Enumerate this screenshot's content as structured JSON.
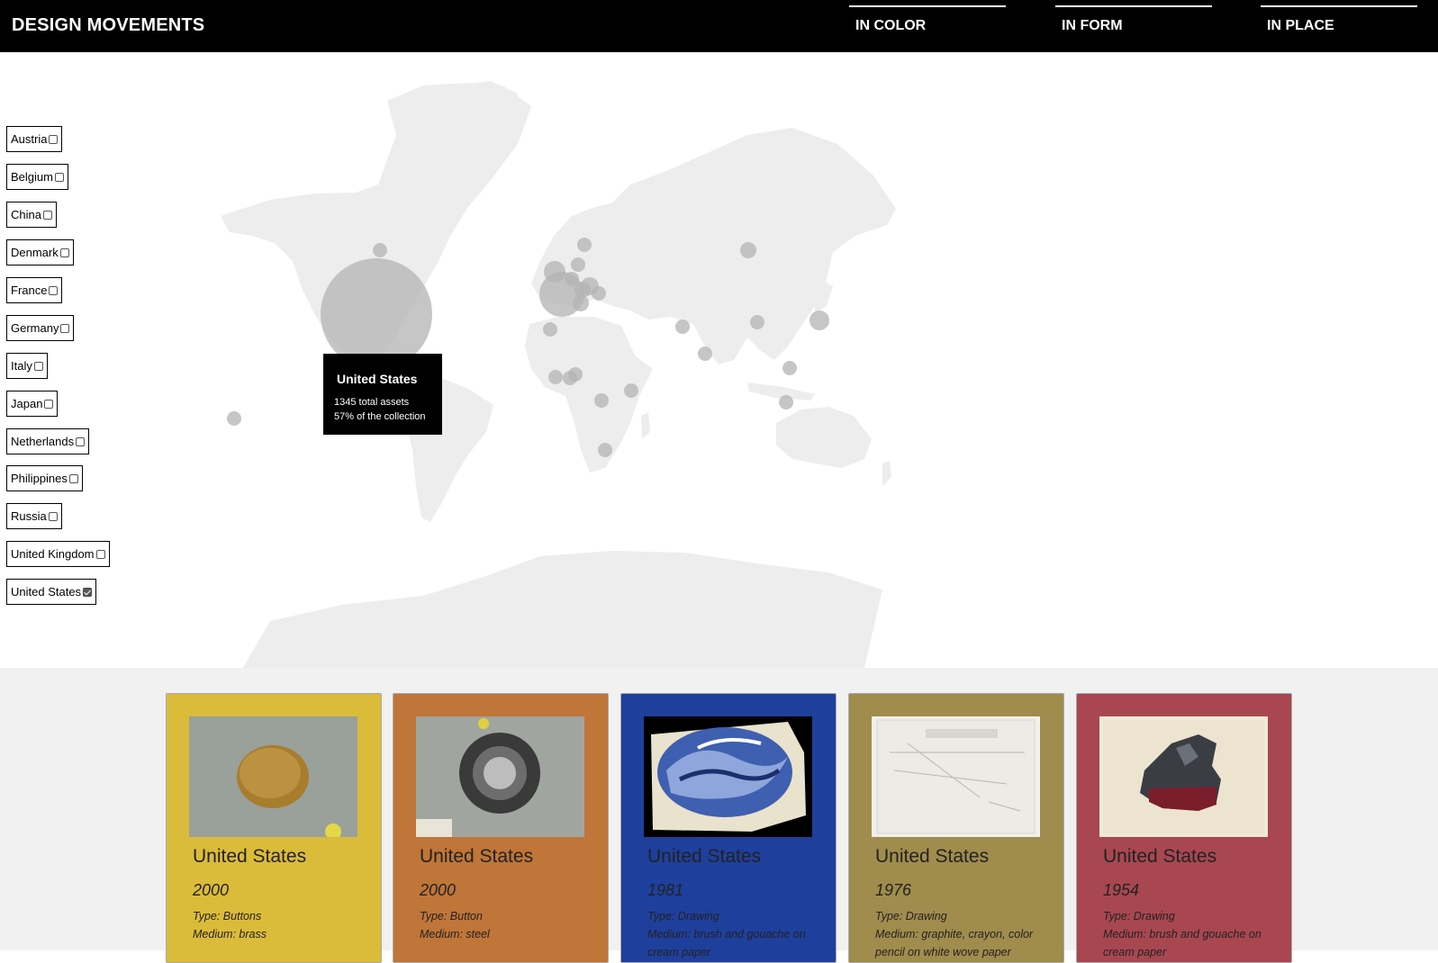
{
  "header": {
    "title": "DESIGN MOVEMENTS",
    "tabs": [
      {
        "label": "IN COLOR"
      },
      {
        "label": "IN FORM"
      },
      {
        "label": "IN PLACE"
      }
    ]
  },
  "filters": [
    {
      "label": "Austria",
      "checked": false
    },
    {
      "label": "Belgium",
      "checked": false
    },
    {
      "label": "China",
      "checked": false
    },
    {
      "label": "Denmark",
      "checked": false
    },
    {
      "label": "France",
      "checked": false
    },
    {
      "label": "Germany",
      "checked": false
    },
    {
      "label": "Italy",
      "checked": false
    },
    {
      "label": "Japan",
      "checked": false
    },
    {
      "label": "Netherlands",
      "checked": false
    },
    {
      "label": "Philippines",
      "checked": false
    },
    {
      "label": "Russia",
      "checked": false
    },
    {
      "label": "United Kingdom",
      "checked": false
    },
    {
      "label": "United States",
      "checked": true
    }
  ],
  "tooltip": {
    "title": "United States",
    "assets": "1345 total assets",
    "share": "57% of the collection"
  },
  "colors": {
    "land": "#ededed",
    "bubble": "#b3b3b3",
    "bubble_opacity": 0.75
  },
  "cards": [
    {
      "country": "United States",
      "year": "2000",
      "type": "Type: Buttons",
      "medium": "Medium: brass",
      "color": "#dbbb3a",
      "thumb": "brass-button"
    },
    {
      "country": "United States",
      "year": "2000",
      "type": "Type: Button",
      "medium": "Medium: steel",
      "color": "#c07539",
      "thumb": "steel-button"
    },
    {
      "country": "United States",
      "year": "1981",
      "type": "Type: Drawing",
      "medium": "Medium: brush and gouache on cream paper",
      "color": "#1e3f9c",
      "thumb": "blue-wave-drawing"
    },
    {
      "country": "United States",
      "year": "1976",
      "type": "Type: Drawing",
      "medium": "Medium: graphite, crayon, color pencil on white wove paper",
      "color": "#a08c4c",
      "thumb": "pencil-sketch"
    },
    {
      "country": "United States",
      "year": "1954",
      "type": "Type: Drawing",
      "medium": "Medium: brush and gouache on cream paper",
      "color": "#a84750",
      "thumb": "dark-object-drawing"
    }
  ]
}
